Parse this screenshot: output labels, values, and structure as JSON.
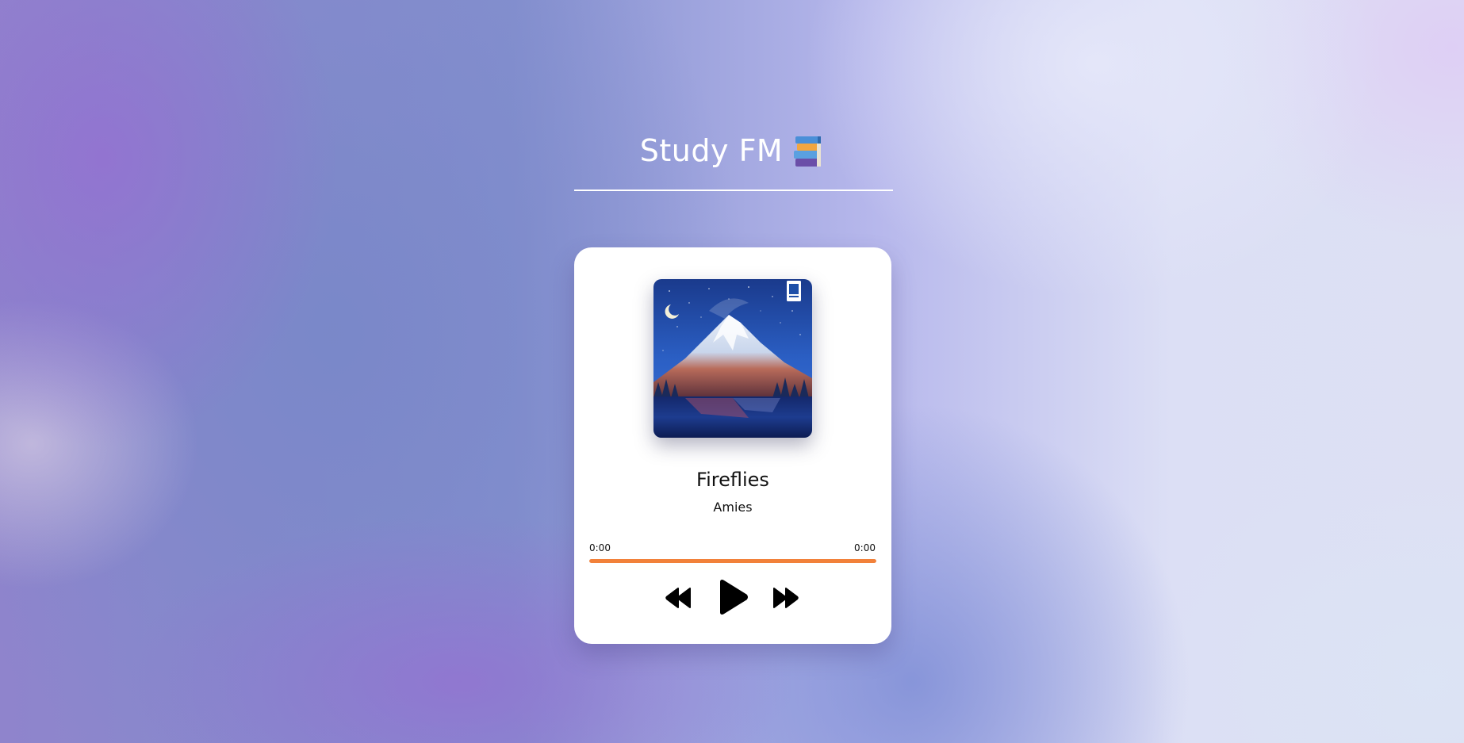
{
  "header": {
    "title": "Study FM",
    "icon": "books-icon"
  },
  "player": {
    "album_art": "mountain-night-artwork",
    "track": {
      "title": "Fireflies",
      "artist": "Amies"
    },
    "time": {
      "current": "0:00",
      "duration": "0:00"
    },
    "progress_fraction": 1.0,
    "controls": {
      "previous_icon": "rewind-icon",
      "play_icon": "play-icon",
      "next_icon": "fast-forward-icon"
    }
  },
  "colors": {
    "accent": "#f2813a",
    "card": "#ffffff",
    "title_text": "#ffffff",
    "control_icons": "#000000"
  }
}
